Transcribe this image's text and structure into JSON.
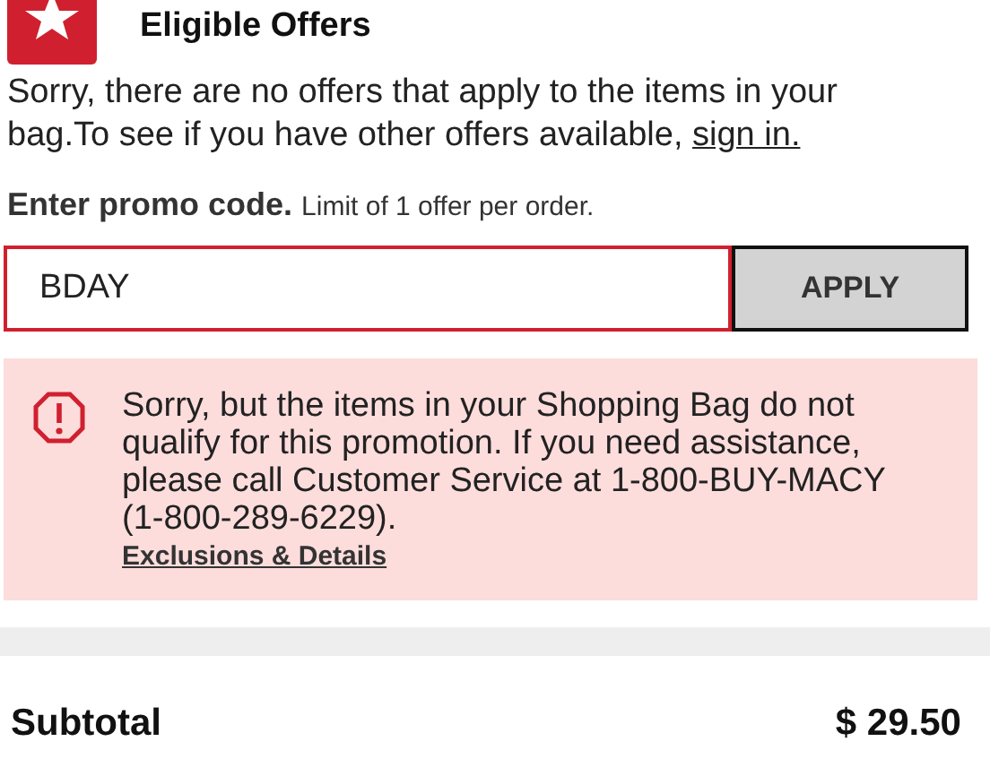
{
  "offers": {
    "title": "Eligible Offers",
    "message": "Sorry, there are no offers that apply to the items in your bag.To see if you have other offers available,",
    "sign_in_link": "sign in."
  },
  "promo": {
    "label": "Enter promo code.",
    "limit": "Limit of 1 offer per order.",
    "value": "BDAY",
    "button": "APPLY",
    "error": true
  },
  "error": {
    "message": "Sorry, but the items in your Shopping Bag do not qualify for this promotion. If you need assistance, please call Customer Service at 1-800-BUY-MACY (1-800-289-6229).",
    "link": "Exclusions & Details"
  },
  "summary": {
    "label": "Subtotal",
    "value": "$ 29.50"
  }
}
